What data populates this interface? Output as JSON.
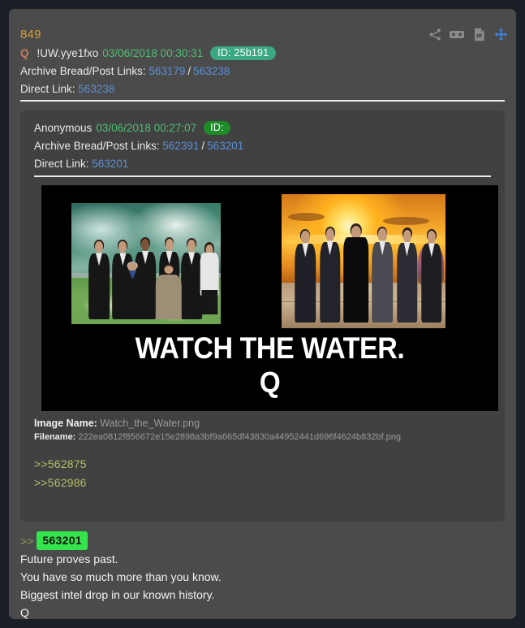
{
  "post": {
    "number": "849",
    "q_mark": "Q",
    "tripcode": "!UW.yye1fxo",
    "timestamp": "03/06/2018 00:30:31",
    "id_badge": "ID: 25b191",
    "archive_label": "Archive Bread/Post Links:",
    "archive_link_1": "563179",
    "archive_separator": "/",
    "archive_link_2": "563238",
    "direct_label": "Direct Link:",
    "direct_link": "563238"
  },
  "toolbar": {
    "icons": [
      {
        "name": "share-icon",
        "title": "Share"
      },
      {
        "name": "vr-goggles-icon",
        "title": "VR"
      },
      {
        "name": "image-document-icon",
        "title": "Image"
      },
      {
        "name": "move-arrows-icon",
        "title": "Move"
      }
    ]
  },
  "quoted_post": {
    "author": "Anonymous",
    "timestamp": "03/06/2018 00:27:07",
    "id_badge": "ID:",
    "archive_label": "Archive Bread/Post Links:",
    "archive_link_1": "562391",
    "archive_separator": "/",
    "archive_link_2": "563201",
    "direct_label": "Direct Link:",
    "direct_link": "563201",
    "attachment": {
      "image_name_label": "Image Name:",
      "image_name": "Watch_the_Water.png",
      "filename_label": "Filename:",
      "filename": "222ea0812f856672e15e2898a3bf9a665df43830a44952441d696f4624b832bf.png",
      "meme_headline": "WATCH THE WATER.",
      "meme_signature": "Q"
    },
    "quote_links": [
      ">>562875",
      ">>562986"
    ]
  },
  "reply": {
    "ref_arrows": ">>",
    "ref_number": "563201",
    "lines": [
      "Future proves past.",
      "You have so much more than you know.",
      "Biggest intel drop in our known history.",
      "Q"
    ]
  },
  "colors": {
    "page_background": "#1b1f27",
    "card_background": "#4b4b4b",
    "inner_card_background": "#414141",
    "post_number": "#d9a330",
    "timestamp_green": "#4fbf72",
    "link_blue": "#5b8fd6",
    "id_badge_teal": "#3aa883",
    "id_badge_green": "#1d8a27",
    "greentext": "#b5bd68",
    "ref_highlight": "#33e54a",
    "accent_blue_icon": "#3b82d9"
  }
}
